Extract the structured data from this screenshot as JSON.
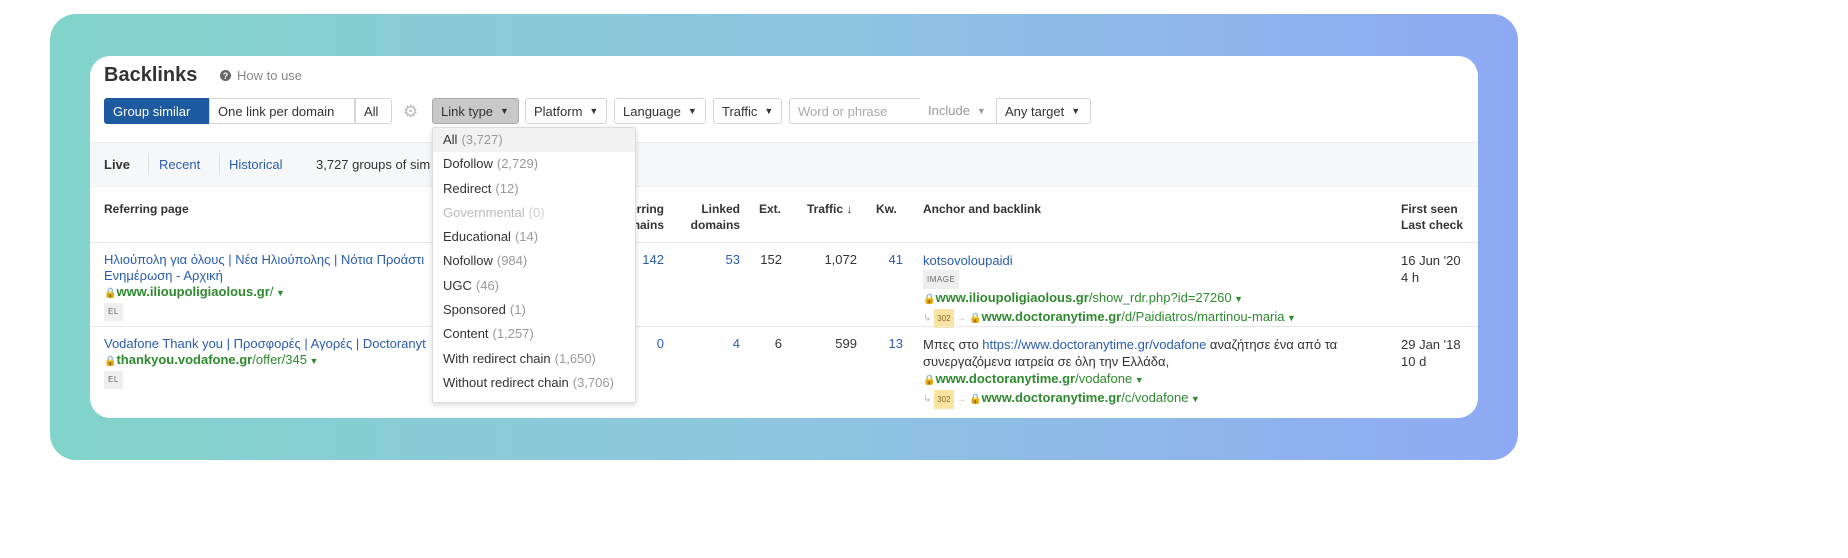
{
  "header": {
    "title": "Backlinks",
    "how_to_use": "How to use"
  },
  "toolbar": {
    "group_similar": "Group similar",
    "one_link_per_domain": "One link per domain",
    "all": "All",
    "link_type": "Link type",
    "platform": "Platform",
    "language": "Language",
    "traffic": "Traffic",
    "search_placeholder": "Word or phrase",
    "include": "Include",
    "any_target": "Any target"
  },
  "tabs": {
    "live": "Live",
    "recent": "Recent",
    "historical": "Historical",
    "summary": "3,727 groups of sim"
  },
  "columns": {
    "referring_page": "Referring page",
    "referring_domains": "Referring domains",
    "linked_domains": "Linked domains",
    "ext": "Ext.",
    "traffic": "Traffic ↓",
    "kw": "Kw.",
    "anchor": "Anchor and backlink",
    "first_seen": "First seen",
    "last_check": "Last check"
  },
  "rows": [
    {
      "title": "Ηλιούπολη για όλους | Νέα Ηλιούπολης | Νότια Προάστι",
      "title2": "Ενημέρωση - Αρχική",
      "domain": "www.ilioupoligiaolous.gr",
      "path": "/",
      "lang": "EL",
      "rd": "142",
      "ld": "53",
      "ext": "152",
      "traffic": "1,072",
      "kw": "41",
      "anchor": "kotsovoloupaidi",
      "anchor_tag": "IMAGE",
      "backlink_domain": "www.ilioupoligiaolous.gr",
      "backlink_path": "/show_rdr.php?id=27260",
      "redirect_code": "302",
      "redirect_domain": "www.doctoranytime.gr",
      "redirect_path": "/d/Paidiatros/martinou-maria",
      "first_seen": "16 Jun '20",
      "last_check": "4 h"
    },
    {
      "title": "Vodafone Thank you | Προσφορές | Αγορές | Doctoranyt",
      "domain": "thankyou.vodafone.gr",
      "path": "/offer/345",
      "lang": "EL",
      "rd": "0",
      "ld": "4",
      "ext": "6",
      "traffic": "599",
      "kw": "13",
      "anchor_pre": "Μπες στο ",
      "anchor_link": "https://www.doctoranytime.gr/vodafone",
      "anchor_post": " αναζήτησε ένα από τα",
      "anchor_line2": "συνεργαζόμενα ιατρεία σε όλη την Ελλάδα,",
      "backlink_domain": "www.doctoranytime.gr",
      "backlink_path": "/vodafone",
      "redirect_code": "302",
      "redirect_domain": "www.doctoranytime.gr",
      "redirect_path": "/c/vodafone",
      "first_seen": "29 Jan '18",
      "last_check": "10 d"
    }
  ],
  "link_type_menu": [
    {
      "label": "All",
      "count": "(3,727)"
    },
    {
      "label": "Dofollow",
      "count": "(2,729)"
    },
    {
      "label": "Redirect",
      "count": "(12)"
    },
    {
      "label": "Governmental",
      "count": "(0)"
    },
    {
      "label": "Educational",
      "count": "(14)"
    },
    {
      "label": "Nofollow",
      "count": "(984)"
    },
    {
      "label": "UGC",
      "count": "(46)"
    },
    {
      "label": "Sponsored",
      "count": "(1)"
    },
    {
      "label": "Content",
      "count": "(1,257)"
    },
    {
      "label": "With redirect chain",
      "count": "(1,650)"
    },
    {
      "label": "Without redirect chain",
      "count": "(3,706)"
    }
  ],
  "colors": {
    "primary": "#1d5aa0",
    "link": "#2a5db0",
    "url_green": "#2e8a2e"
  }
}
